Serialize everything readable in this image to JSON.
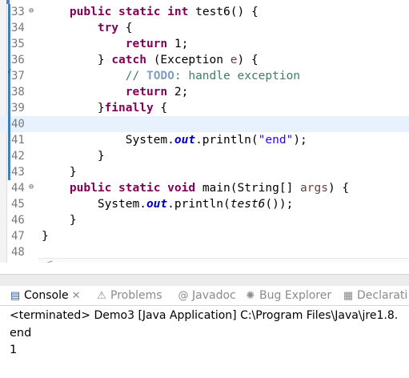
{
  "editor": {
    "lines": [
      {
        "n": "33",
        "fold": "minus",
        "segs": [
          [
            "",
            "    "
          ],
          [
            "kw",
            "public"
          ],
          [
            "",
            " "
          ],
          [
            "kw",
            "static"
          ],
          [
            "",
            " "
          ],
          [
            "kw",
            "int"
          ],
          [
            "",
            " test6() {"
          ]
        ]
      },
      {
        "n": "34",
        "segs": [
          [
            "",
            "        "
          ],
          [
            "kw",
            "try"
          ],
          [
            "",
            " {"
          ]
        ]
      },
      {
        "n": "35",
        "segs": [
          [
            "",
            "            "
          ],
          [
            "kw",
            "return"
          ],
          [
            "",
            " 1;"
          ]
        ]
      },
      {
        "n": "36",
        "segs": [
          [
            "",
            "        } "
          ],
          [
            "kw",
            "catch"
          ],
          [
            "",
            " (Exception "
          ],
          [
            "pm",
            "e"
          ],
          [
            "",
            ") {"
          ]
        ]
      },
      {
        "n": "37",
        "task": true,
        "segs": [
          [
            "",
            "            "
          ],
          [
            "cm",
            "// "
          ],
          [
            "todo",
            "TODO"
          ],
          [
            "cm",
            ": handle exception"
          ]
        ]
      },
      {
        "n": "38",
        "segs": [
          [
            "",
            "            "
          ],
          [
            "kw",
            "return"
          ],
          [
            "",
            " 2;"
          ]
        ]
      },
      {
        "n": "39",
        "segs": [
          [
            "",
            "        }"
          ],
          [
            "kw",
            "finally"
          ],
          [
            "",
            " {"
          ]
        ]
      },
      {
        "n": "40",
        "current": true,
        "segs": []
      },
      {
        "n": "41",
        "segs": [
          [
            "",
            "            System."
          ],
          [
            "sf",
            "out"
          ],
          [
            "",
            ".println("
          ],
          [
            "str",
            "\"end\""
          ],
          [
            "",
            ");"
          ]
        ]
      },
      {
        "n": "42",
        "segs": [
          [
            "",
            "        }"
          ]
        ]
      },
      {
        "n": "43",
        "segs": [
          [
            "",
            "    }"
          ]
        ]
      },
      {
        "n": "44",
        "fold": "minus",
        "segs": [
          [
            "",
            "    "
          ],
          [
            "kw",
            "public"
          ],
          [
            "",
            " "
          ],
          [
            "kw",
            "static"
          ],
          [
            "",
            " "
          ],
          [
            "kw",
            "void"
          ],
          [
            "",
            " main(String[] "
          ],
          [
            "pm",
            "args"
          ],
          [
            "",
            ") {"
          ]
        ]
      },
      {
        "n": "45",
        "segs": [
          [
            "",
            "        System."
          ],
          [
            "sf",
            "out"
          ],
          [
            "",
            ".println("
          ],
          [
            "im",
            "test6"
          ],
          [
            "",
            "());"
          ]
        ]
      },
      {
        "n": "46",
        "segs": [
          [
            "",
            "    }"
          ]
        ]
      },
      {
        "n": "47",
        "segs": [
          [
            "",
            "}"
          ]
        ]
      },
      {
        "n": "48",
        "segs": []
      }
    ],
    "scroll_left_glyph": "<"
  },
  "tabs": [
    {
      "label": "Console",
      "icon": "console-icon",
      "glyph": "▤",
      "close": "✕",
      "active": true
    },
    {
      "label": "Problems",
      "icon": "problems-icon",
      "glyph": "⚠",
      "active": false
    },
    {
      "label": "Javadoc",
      "icon": "javadoc-icon",
      "glyph": "@",
      "active": false
    },
    {
      "label": "Bug Explorer",
      "icon": "bug-icon",
      "glyph": "✺",
      "active": false
    },
    {
      "label": "Declarati",
      "icon": "declaration-icon",
      "glyph": "▦",
      "active": false
    }
  ],
  "console": {
    "header": "<terminated> Demo3 [Java Application] C:\\Program Files\\Java\\jre1.8.",
    "output": [
      "end",
      "1"
    ]
  },
  "colors": {
    "keyword": "#7f0055",
    "comment": "#3f7f5f",
    "string": "#2a00ff",
    "field": "#0000c0",
    "current_line": "#e8f2fe"
  }
}
